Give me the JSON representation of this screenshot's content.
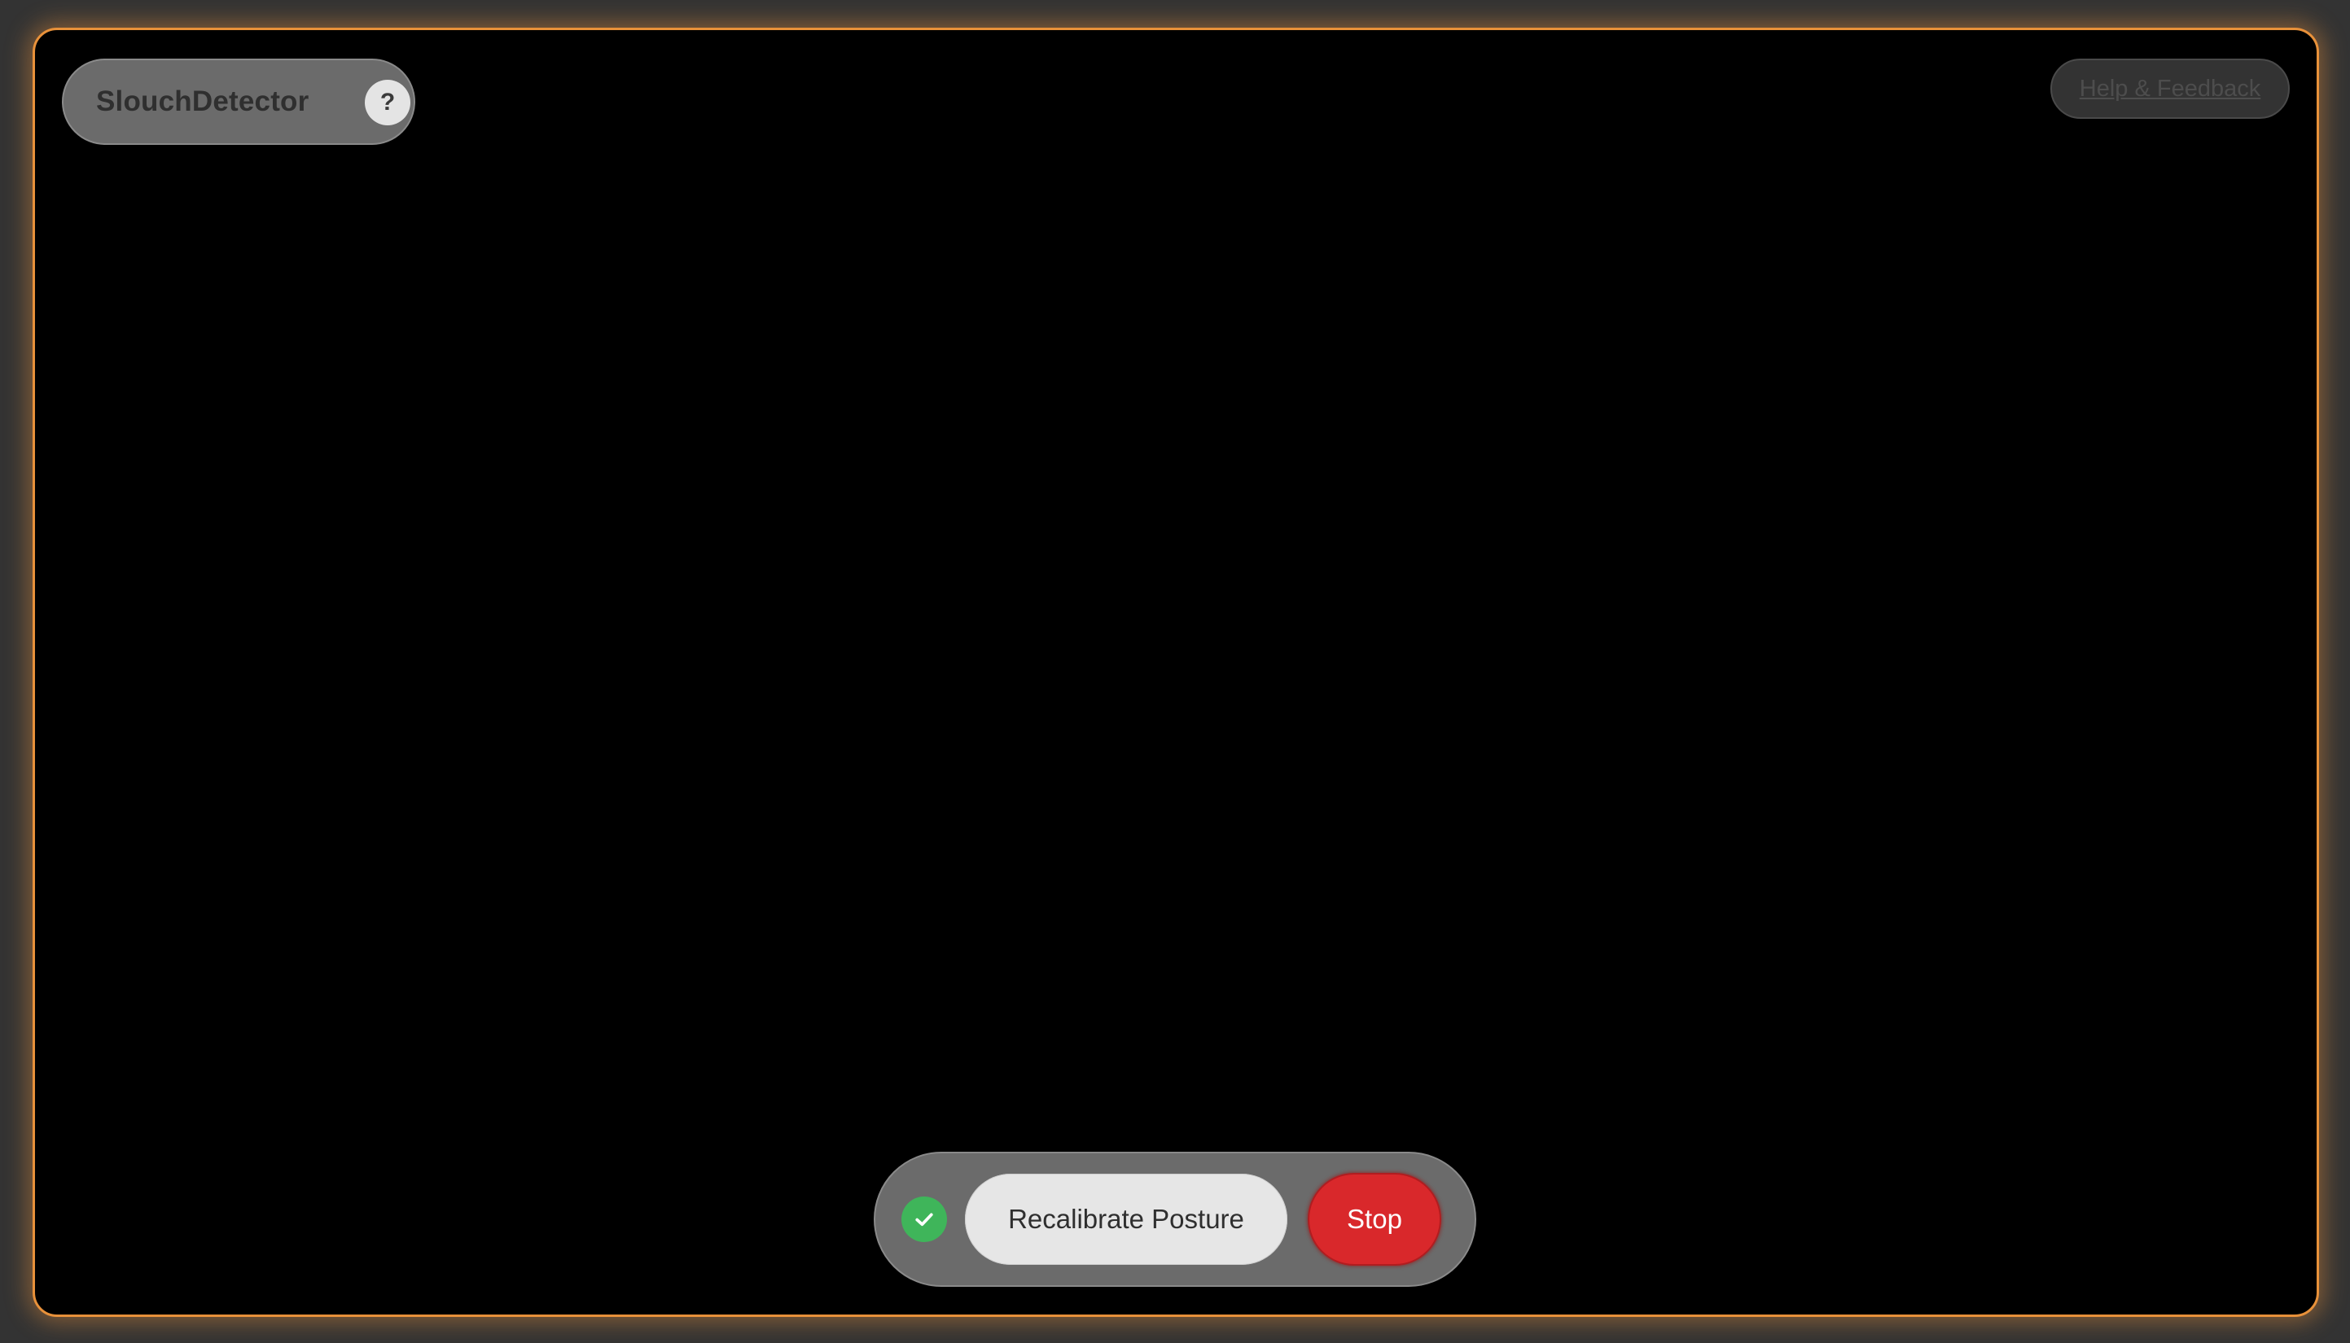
{
  "app": {
    "name": "SlouchDetector",
    "help_button_label": "?"
  },
  "header": {
    "help_link_label": "Help & Feedback"
  },
  "controls": {
    "status_icon": "check-icon",
    "status": "ok",
    "recalibrate_label": "Recalibrate Posture",
    "stop_label": "Stop"
  },
  "colors": {
    "frame_border": "#e8913a",
    "status_ok": "#3fb55a",
    "stop_button": "#d9282b",
    "recalibrate_button": "#e6e6e6",
    "pill_background": "#6b6b6b",
    "video_background": "#000000"
  }
}
